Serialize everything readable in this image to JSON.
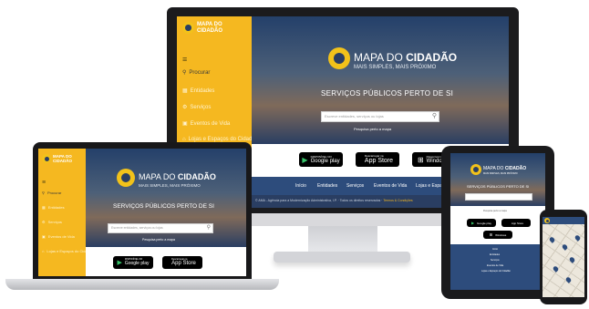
{
  "brand": {
    "name_light": "MAPA DO ",
    "name_bold": "CIDADÃO",
    "tagline": "MAIS SIMPLES, MAIS PRÓXIMO",
    "sidebar_logo_line1": "MAPA DO",
    "sidebar_logo_line2": "CIDADÃO"
  },
  "hero": {
    "subtitle": "SERVIÇOS PÚBLICOS PERTO DE SI",
    "search_placeholder": "Escreve entidades, serviços ou lojas",
    "search_link": "Pesquisa perto a mapa"
  },
  "sidebar": {
    "items": [
      {
        "icon": "search-icon",
        "label": "Procurar"
      },
      {
        "icon": "building-icon",
        "label": "Entidades"
      },
      {
        "icon": "gear-icon",
        "label": "Serviços"
      },
      {
        "icon": "calendar-icon",
        "label": "Eventos de Vida"
      },
      {
        "icon": "store-icon",
        "label": "Lojas e Espaços do Cidadão"
      }
    ]
  },
  "stores": {
    "google_small": "DISPONÍVEL NO",
    "google_big": "Google play",
    "apple_small": "Descarregar na",
    "apple_big": "App Store",
    "windows_small": "Disponível na",
    "windows_big": "Windows"
  },
  "nav": [
    "Início",
    "Entidades",
    "Serviços",
    "Eventos de Vida",
    "Lojas e Espa"
  ],
  "footer": {
    "text": "© AMA - Agência para a Modernização Administrativa, I.P. · Todos os direitos reservados ·",
    "link": "Termos & Condições"
  },
  "colors": {
    "accent": "#f5b820",
    "navy": "#2d4c7c",
    "hero": "#1e3356"
  }
}
